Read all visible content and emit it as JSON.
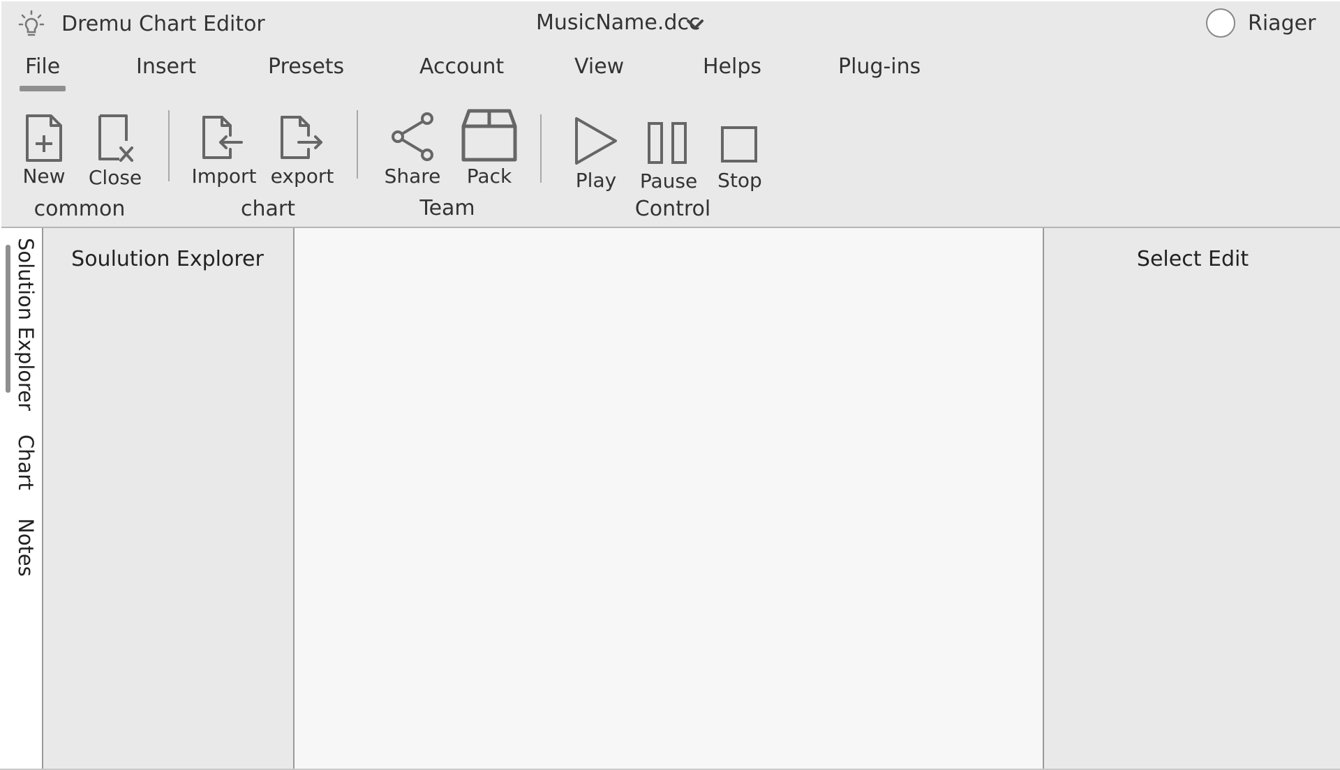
{
  "app": {
    "title": "Dremu Chart Editor",
    "file_name": "MusicName.dcc",
    "user_name": "Riager",
    "logo_icon": "lightbulb-icon"
  },
  "menu": {
    "items": [
      {
        "label": "File",
        "active": true
      },
      {
        "label": "Insert"
      },
      {
        "label": "Presets"
      },
      {
        "label": "Account"
      },
      {
        "label": "View"
      },
      {
        "label": "Helps"
      },
      {
        "label": "Plug-ins"
      }
    ]
  },
  "ribbon": {
    "groups": [
      {
        "label": "common",
        "tools": [
          {
            "label": "New",
            "icon": "new-file-icon"
          },
          {
            "label": "Close",
            "icon": "close-file-icon"
          }
        ]
      },
      {
        "label": "chart",
        "tools": [
          {
            "label": "Import",
            "icon": "import-icon"
          },
          {
            "label": "export",
            "icon": "export-icon"
          }
        ]
      },
      {
        "label": "Team",
        "tools": [
          {
            "label": "Share",
            "icon": "share-icon"
          },
          {
            "label": "Pack",
            "icon": "package-icon"
          }
        ]
      },
      {
        "label": "Control",
        "tools": [
          {
            "label": "Play",
            "icon": "play-icon"
          },
          {
            "label": "Pause",
            "icon": "pause-icon"
          },
          {
            "label": "Stop",
            "icon": "stop-icon"
          }
        ]
      }
    ]
  },
  "side_tabs": [
    {
      "label": "Solution Explorer",
      "active": true
    },
    {
      "label": "Chart"
    },
    {
      "label": "Notes"
    }
  ],
  "panels": {
    "explorer_title": "Soulution Explorer",
    "select_edit_title": "Select Edit"
  },
  "colors": {
    "chrome": "#e9e9e9",
    "canvas": "#f7f7f7",
    "icon_stroke": "#666666",
    "accent_underline": "#8f8f8f"
  }
}
